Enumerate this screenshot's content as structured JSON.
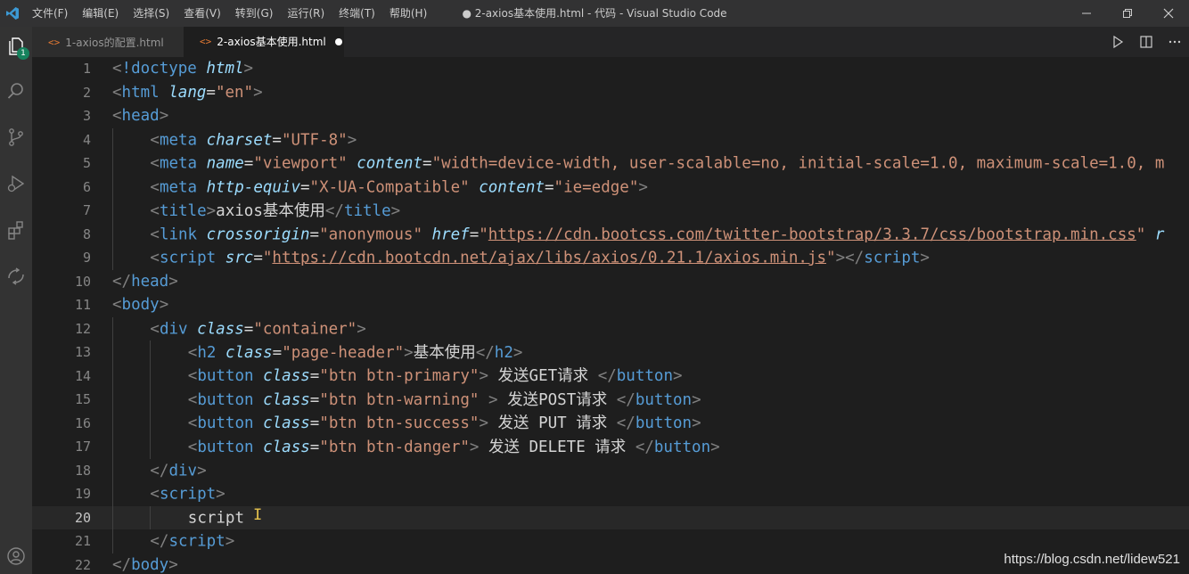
{
  "titlebar": {
    "menus": [
      "文件(F)",
      "编辑(E)",
      "选择(S)",
      "查看(V)",
      "转到(G)",
      "运行(R)",
      "终端(T)",
      "帮助(H)"
    ],
    "window_title": "● 2-axios基本使用.html - 代码 - Visual Studio Code"
  },
  "activity": {
    "explorer_badge": "1"
  },
  "tabs": [
    {
      "label": "1-axios的配置.html",
      "icon": "html-icon",
      "active": false
    },
    {
      "label": "2-axios基本使用.html",
      "icon": "html-icon",
      "active": true,
      "dirty": true
    }
  ],
  "colors": {
    "tag": "#569cd6",
    "attr": "#9cdcfe",
    "string": "#ce9178",
    "punct": "#808080",
    "text": "#d4d4d4",
    "badge": "#16825d"
  },
  "editor": {
    "current_line": 20,
    "lines": [
      {
        "n": "1",
        "i": 0,
        "t": [
          [
            "p",
            "<"
          ],
          [
            "t",
            "!doctype"
          ],
          [
            "x",
            " "
          ],
          [
            "a",
            "html"
          ],
          [
            "p",
            ">"
          ]
        ]
      },
      {
        "n": "2",
        "i": 0,
        "t": [
          [
            "p",
            "<"
          ],
          [
            "t",
            "html"
          ],
          [
            "x",
            " "
          ],
          [
            "a",
            "lang"
          ],
          [
            "x",
            "="
          ],
          [
            "s",
            "\"en\""
          ],
          [
            "p",
            ">"
          ]
        ]
      },
      {
        "n": "3",
        "i": 0,
        "t": [
          [
            "p",
            "<"
          ],
          [
            "t",
            "head"
          ],
          [
            "p",
            ">"
          ]
        ]
      },
      {
        "n": "4",
        "i": 1,
        "t": [
          [
            "p",
            "<"
          ],
          [
            "t",
            "meta"
          ],
          [
            "x",
            " "
          ],
          [
            "a",
            "charset"
          ],
          [
            "x",
            "="
          ],
          [
            "s",
            "\"UTF-8\""
          ],
          [
            "p",
            ">"
          ]
        ]
      },
      {
        "n": "5",
        "i": 1,
        "t": [
          [
            "p",
            "<"
          ],
          [
            "t",
            "meta"
          ],
          [
            "x",
            " "
          ],
          [
            "a",
            "name"
          ],
          [
            "x",
            "="
          ],
          [
            "s",
            "\"viewport\""
          ],
          [
            "x",
            " "
          ],
          [
            "a",
            "content"
          ],
          [
            "x",
            "="
          ],
          [
            "s",
            "\"width=device-width, user-scalable=no, initial-scale=1.0, maximum-scale=1.0, m"
          ]
        ]
      },
      {
        "n": "6",
        "i": 1,
        "t": [
          [
            "p",
            "<"
          ],
          [
            "t",
            "meta"
          ],
          [
            "x",
            " "
          ],
          [
            "a",
            "http-equiv"
          ],
          [
            "x",
            "="
          ],
          [
            "s",
            "\"X-UA-Compatible\""
          ],
          [
            "x",
            " "
          ],
          [
            "a",
            "content"
          ],
          [
            "x",
            "="
          ],
          [
            "s",
            "\"ie=edge\""
          ],
          [
            "p",
            ">"
          ]
        ]
      },
      {
        "n": "7",
        "i": 1,
        "t": [
          [
            "p",
            "<"
          ],
          [
            "t",
            "title"
          ],
          [
            "p",
            ">"
          ],
          [
            "x",
            "axios基本使用"
          ],
          [
            "p",
            "</"
          ],
          [
            "t",
            "title"
          ],
          [
            "p",
            ">"
          ]
        ]
      },
      {
        "n": "8",
        "i": 1,
        "t": [
          [
            "p",
            "<"
          ],
          [
            "t",
            "link"
          ],
          [
            "x",
            " "
          ],
          [
            "a",
            "crossorigin"
          ],
          [
            "x",
            "="
          ],
          [
            "s",
            "\"anonymous\""
          ],
          [
            "x",
            " "
          ],
          [
            "a",
            "href"
          ],
          [
            "x",
            "="
          ],
          [
            "s",
            "\""
          ],
          [
            "u",
            "https://cdn.bootcss.com/twitter-bootstrap/3.3.7/css/bootstrap.min.css"
          ],
          [
            "s",
            "\""
          ],
          [
            "x",
            " "
          ],
          [
            "a",
            "r"
          ]
        ]
      },
      {
        "n": "9",
        "i": 1,
        "t": [
          [
            "p",
            "<"
          ],
          [
            "t",
            "script"
          ],
          [
            "x",
            " "
          ],
          [
            "a",
            "src"
          ],
          [
            "x",
            "="
          ],
          [
            "s",
            "\""
          ],
          [
            "u",
            "https://cdn.bootcdn.net/ajax/libs/axios/0.21.1/axios.min.js"
          ],
          [
            "s",
            "\""
          ],
          [
            "p",
            "></"
          ],
          [
            "t",
            "script"
          ],
          [
            "p",
            ">"
          ]
        ]
      },
      {
        "n": "10",
        "i": 0,
        "t": [
          [
            "p",
            "</"
          ],
          [
            "t",
            "head"
          ],
          [
            "p",
            ">"
          ]
        ]
      },
      {
        "n": "11",
        "i": 0,
        "t": [
          [
            "p",
            "<"
          ],
          [
            "t",
            "body"
          ],
          [
            "p",
            ">"
          ]
        ]
      },
      {
        "n": "12",
        "i": 1,
        "t": [
          [
            "p",
            "<"
          ],
          [
            "t",
            "div"
          ],
          [
            "x",
            " "
          ],
          [
            "a",
            "class"
          ],
          [
            "x",
            "="
          ],
          [
            "s",
            "\"container\""
          ],
          [
            "p",
            ">"
          ]
        ]
      },
      {
        "n": "13",
        "i": 2,
        "t": [
          [
            "p",
            "<"
          ],
          [
            "t",
            "h2"
          ],
          [
            "x",
            " "
          ],
          [
            "a",
            "class"
          ],
          [
            "x",
            "="
          ],
          [
            "s",
            "\"page-header\""
          ],
          [
            "p",
            ">"
          ],
          [
            "x",
            "基本使用"
          ],
          [
            "p",
            "</"
          ],
          [
            "t",
            "h2"
          ],
          [
            "p",
            ">"
          ]
        ]
      },
      {
        "n": "14",
        "i": 2,
        "t": [
          [
            "p",
            "<"
          ],
          [
            "t",
            "button"
          ],
          [
            "x",
            " "
          ],
          [
            "a",
            "class"
          ],
          [
            "x",
            "="
          ],
          [
            "s",
            "\"btn btn-primary\""
          ],
          [
            "p",
            ">"
          ],
          [
            "x",
            " 发送GET请求 "
          ],
          [
            "p",
            "</"
          ],
          [
            "t",
            "button"
          ],
          [
            "p",
            ">"
          ]
        ]
      },
      {
        "n": "15",
        "i": 2,
        "t": [
          [
            "p",
            "<"
          ],
          [
            "t",
            "button"
          ],
          [
            "x",
            " "
          ],
          [
            "a",
            "class"
          ],
          [
            "x",
            "="
          ],
          [
            "s",
            "\"btn btn-warning\""
          ],
          [
            "x",
            " "
          ],
          [
            "p",
            ">"
          ],
          [
            "x",
            " 发送POST请求 "
          ],
          [
            "p",
            "</"
          ],
          [
            "t",
            "button"
          ],
          [
            "p",
            ">"
          ]
        ]
      },
      {
        "n": "16",
        "i": 2,
        "t": [
          [
            "p",
            "<"
          ],
          [
            "t",
            "button"
          ],
          [
            "x",
            " "
          ],
          [
            "a",
            "class"
          ],
          [
            "x",
            "="
          ],
          [
            "s",
            "\"btn btn-success\""
          ],
          [
            "p",
            ">"
          ],
          [
            "x",
            " 发送 PUT 请求 "
          ],
          [
            "p",
            "</"
          ],
          [
            "t",
            "button"
          ],
          [
            "p",
            ">"
          ]
        ]
      },
      {
        "n": "17",
        "i": 2,
        "t": [
          [
            "p",
            "<"
          ],
          [
            "t",
            "button"
          ],
          [
            "x",
            " "
          ],
          [
            "a",
            "class"
          ],
          [
            "x",
            "="
          ],
          [
            "s",
            "\"btn btn-danger\""
          ],
          [
            "p",
            ">"
          ],
          [
            "x",
            " 发送 DELETE 请求 "
          ],
          [
            "p",
            "</"
          ],
          [
            "t",
            "button"
          ],
          [
            "p",
            ">"
          ]
        ]
      },
      {
        "n": "18",
        "i": 1,
        "t": [
          [
            "p",
            "</"
          ],
          [
            "t",
            "div"
          ],
          [
            "p",
            ">"
          ]
        ]
      },
      {
        "n": "19",
        "i": 1,
        "t": [
          [
            "p",
            "<"
          ],
          [
            "t",
            "script"
          ],
          [
            "p",
            ">"
          ]
        ]
      },
      {
        "n": "20",
        "i": 2,
        "t": [
          [
            "x",
            "script "
          ]
        ]
      },
      {
        "n": "21",
        "i": 1,
        "t": [
          [
            "p",
            "</"
          ],
          [
            "t",
            "script"
          ],
          [
            "p",
            ">"
          ]
        ]
      },
      {
        "n": "22",
        "i": 0,
        "t": [
          [
            "p",
            "</"
          ],
          [
            "t",
            "body"
          ],
          [
            "p",
            ">"
          ]
        ]
      }
    ]
  },
  "watermark": "https://blog.csdn.net/lidew521"
}
